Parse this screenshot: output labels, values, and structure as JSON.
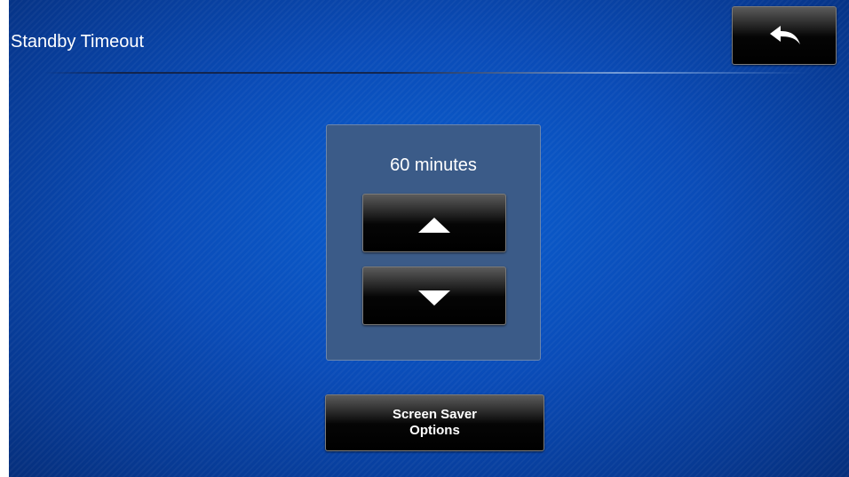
{
  "header": {
    "title": "Standby Timeout",
    "back_icon": "back-arrow-icon"
  },
  "timeout": {
    "value_label": "60 minutes",
    "increase_icon": "triangle-up-icon",
    "decrease_icon": "triangle-down-icon"
  },
  "footer": {
    "screensaver_label": "Screen Saver\nOptions"
  },
  "colors": {
    "background": "#0a4cb8",
    "panel": "#3b5b88",
    "button": "#000000",
    "text": "#ffffff"
  }
}
